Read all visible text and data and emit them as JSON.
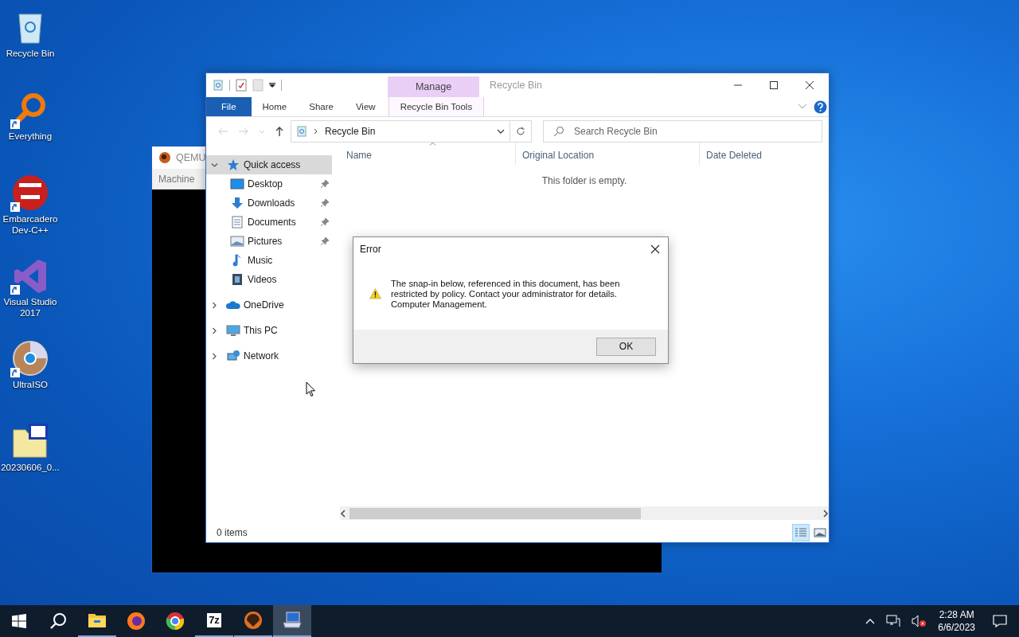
{
  "desktop_icons": [
    {
      "kind": "recycle",
      "label": "Recycle Bin",
      "shortcut": false
    },
    {
      "kind": "search",
      "label": "Everything",
      "shortcut": true
    },
    {
      "kind": "devcpp",
      "label": "Embarcadero Dev-C++",
      "shortcut": true
    },
    {
      "kind": "vs",
      "label": "Visual Studio 2017",
      "shortcut": true
    },
    {
      "kind": "disc",
      "label": "UltraISO",
      "shortcut": true
    },
    {
      "kind": "iso",
      "label": "20230606_0...",
      "shortcut": false
    }
  ],
  "qemu_window": {
    "title": "QEMU",
    "menu": [
      "Machine"
    ]
  },
  "explorer": {
    "title": "Recycle Bin",
    "context_group": "Manage",
    "ribbon_tabs": [
      {
        "kind": "file",
        "label": "File"
      },
      {
        "kind": "normal",
        "label": "Home"
      },
      {
        "kind": "normal",
        "label": "Share"
      },
      {
        "kind": "normal",
        "label": "View"
      },
      {
        "kind": "contextual",
        "label": "Recycle Bin Tools"
      }
    ],
    "address": "Recycle Bin",
    "search": {
      "placeholder": "Search Recycle Bin"
    },
    "nav": [
      {
        "kind": "star",
        "label": "Quick access",
        "expanded": true,
        "selected": true,
        "children": [
          {
            "kind": "desktop",
            "label": "Desktop",
            "pinned": true,
            "selected": false
          },
          {
            "kind": "download",
            "label": "Downloads",
            "pinned": true,
            "selected": false
          },
          {
            "kind": "document",
            "label": "Documents",
            "pinned": true,
            "selected": false
          },
          {
            "kind": "picture",
            "label": "Pictures",
            "pinned": true,
            "selected": false
          },
          {
            "kind": "music",
            "label": "Music",
            "pinned": false,
            "selected": false
          },
          {
            "kind": "video",
            "label": "Videos",
            "pinned": false,
            "selected": false
          }
        ]
      },
      {
        "kind": "cloud",
        "label": "OneDrive",
        "expanded": false,
        "selected": false
      },
      {
        "kind": "pc",
        "label": "This PC",
        "expanded": false,
        "selected": false
      },
      {
        "kind": "network",
        "label": "Network",
        "expanded": false,
        "selected": false
      }
    ],
    "columns": [
      {
        "label": "Name",
        "sorted": true
      },
      {
        "label": "Original Location",
        "sorted": false
      },
      {
        "label": "Date Deleted",
        "sorted": false
      }
    ],
    "empty_message": "This folder is empty.",
    "status": "0 items",
    "views": [
      {
        "kind": "details",
        "selected": true
      },
      {
        "kind": "large",
        "selected": false
      }
    ]
  },
  "dialog": {
    "title": "Error",
    "message": "The snap-in below, referenced in this document, has been restricted by policy. Contact your administrator for details. Computer Management.",
    "button": "OK"
  },
  "taskbar": {
    "apps": [
      {
        "kind": "explorer",
        "running": true,
        "active": false
      },
      {
        "kind": "firefox",
        "running": false,
        "active": false
      },
      {
        "kind": "chrome",
        "running": false,
        "active": false
      },
      {
        "kind": "sevenzip",
        "label": "7z",
        "running": true,
        "active": false
      },
      {
        "kind": "qemu",
        "running": true,
        "active": false
      },
      {
        "kind": "mmc",
        "running": true,
        "active": true
      }
    ],
    "time": "2:28 AM",
    "date": "6/6/2023"
  }
}
